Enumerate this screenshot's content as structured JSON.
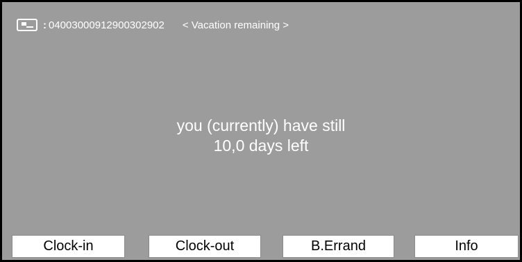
{
  "header": {
    "card_icon": "card-icon",
    "separator": ":",
    "card_number": "04003000912900302902",
    "screen_title": "< Vacation remaining >"
  },
  "message": {
    "line1": "you (currently) have still",
    "line2": "10,0 days left"
  },
  "buttons": {
    "clock_in": "Clock-in",
    "clock_out": "Clock-out",
    "errand": "B.Errand",
    "info": "Info"
  },
  "colors": {
    "screen_background": "#9c9c9c",
    "text": "#ffffff",
    "button_background": "#ffffff",
    "border": "#000000"
  }
}
